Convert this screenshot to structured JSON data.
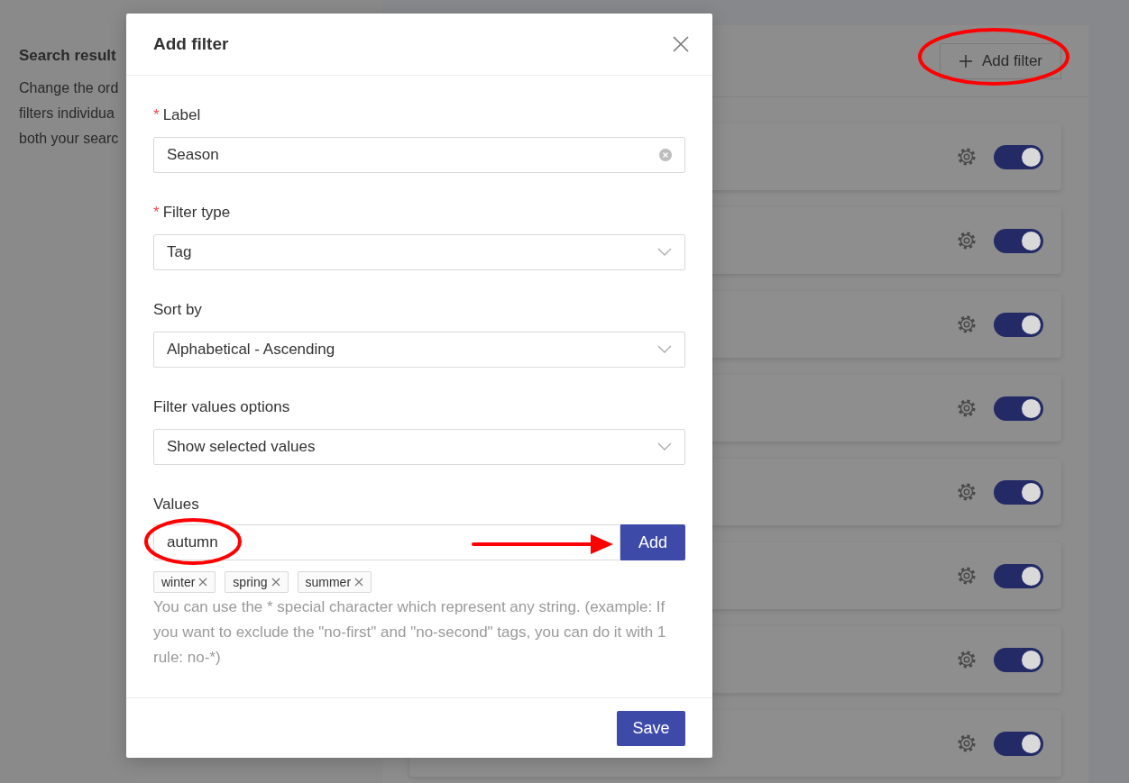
{
  "page": {
    "heading": "Search result",
    "description_lines": [
      "Change the ord",
      "filters individua",
      "both your searc"
    ],
    "add_filter_button": "Add filter",
    "filters": [
      {
        "enabled": true
      },
      {
        "enabled": true
      },
      {
        "enabled": true
      },
      {
        "enabled": true
      },
      {
        "enabled": true
      },
      {
        "enabled": true
      },
      {
        "enabled": true
      },
      {
        "enabled": true
      }
    ]
  },
  "dialog": {
    "title": "Add filter",
    "fields": [
      {
        "kind": "text",
        "required_mark": "*",
        "label": "Label",
        "value": "Season"
      },
      {
        "kind": "select",
        "required_mark": "*",
        "label": "Filter type",
        "value": "Tag"
      },
      {
        "kind": "select",
        "label": "Sort by",
        "value": "Alphabetical - Ascending"
      },
      {
        "kind": "select",
        "label": "Filter values options",
        "value": "Show selected values"
      }
    ],
    "values": {
      "label": "Values",
      "input": "autumn",
      "add_button": "Add",
      "tags": [
        "winter",
        "spring",
        "summer"
      ],
      "help": "You can use the * special character which represent any string. (example: If you want to exclude the \"no-first\" and \"no-second\" tags, you can do it with 1 rule: no-*)"
    },
    "save_button": "Save"
  }
}
